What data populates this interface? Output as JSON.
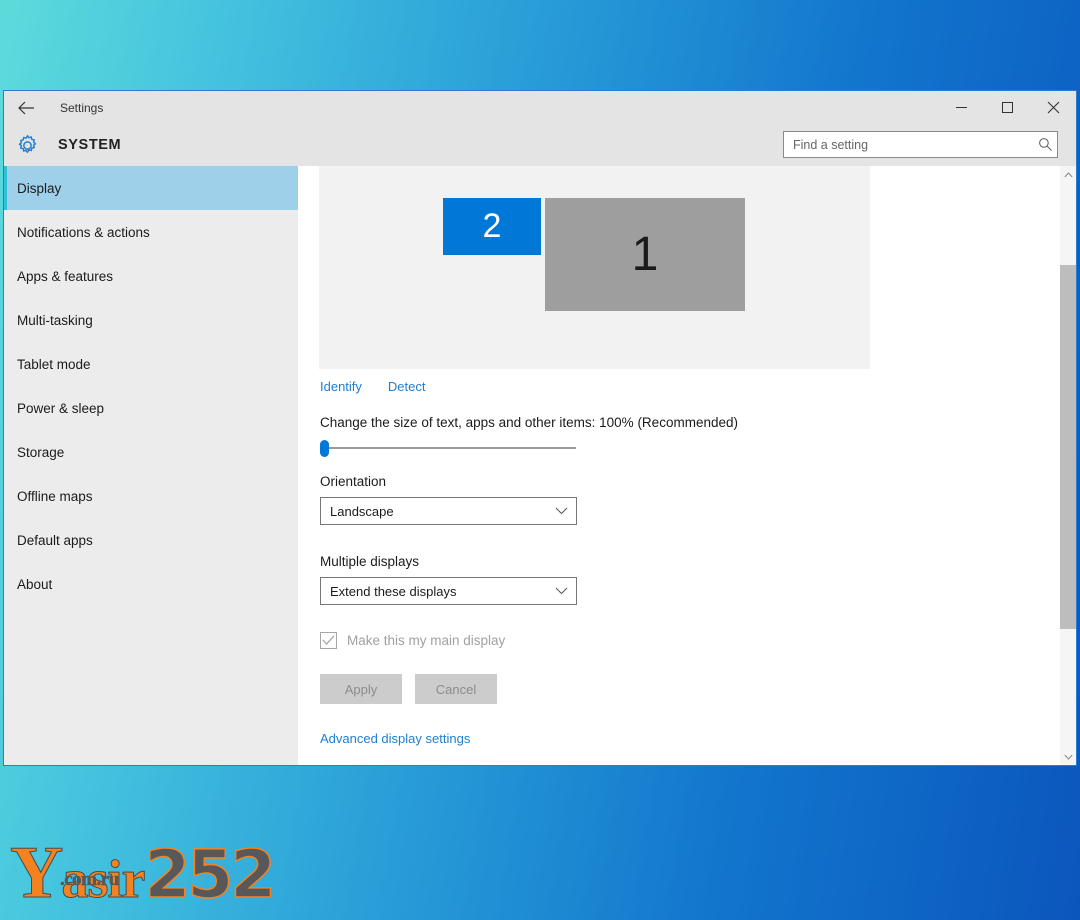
{
  "window": {
    "titlebar_title": "Settings",
    "back_icon": "back-arrow-icon",
    "minimize_label": "–",
    "maximize_label": "□",
    "close_label": "✕"
  },
  "header": {
    "gear_icon": "gear-icon",
    "title": "SYSTEM"
  },
  "search": {
    "placeholder": "Find a setting",
    "value": "",
    "icon": "search-icon"
  },
  "sidebar": {
    "items": [
      {
        "label": "Display",
        "active": true
      },
      {
        "label": "Notifications & actions",
        "active": false
      },
      {
        "label": "Apps & features",
        "active": false
      },
      {
        "label": "Multi-tasking",
        "active": false
      },
      {
        "label": "Tablet mode",
        "active": false
      },
      {
        "label": "Power & sleep",
        "active": false
      },
      {
        "label": "Storage",
        "active": false
      },
      {
        "label": "Offline maps",
        "active": false
      },
      {
        "label": "Default apps",
        "active": false
      },
      {
        "label": "About",
        "active": false
      }
    ]
  },
  "main": {
    "displays": [
      {
        "number": "2",
        "selected": true
      },
      {
        "number": "1",
        "selected": false
      }
    ],
    "identify_link": "Identify",
    "detect_link": "Detect",
    "scale_label": "Change the size of text, apps and other items: 100% (Recommended)",
    "scale_percent": "100%",
    "slider_value": 0,
    "orientation_label": "Orientation",
    "orientation_value": "Landscape",
    "multiple_displays_label": "Multiple displays",
    "multiple_displays_value": "Extend these displays",
    "main_display_checkbox_label": "Make this my main display",
    "main_display_checked": true,
    "main_display_disabled": true,
    "apply_label": "Apply",
    "cancel_label": "Cancel",
    "buttons_disabled": true,
    "advanced_link": "Advanced display settings"
  },
  "watermark": {
    "letter": "Y",
    "word": "asir",
    "domain": ".com.ru",
    "number": "252"
  },
  "colors": {
    "accent_blue": "#0078d7",
    "link_blue": "#1f7fd0",
    "sidebar_active": "#9fd0ea",
    "sidebar_bg": "#ececec",
    "chrome_gray": "#e4e4e4",
    "preview_bg": "#f2f2f2",
    "monitor_inactive": "#9e9e9e",
    "disabled_button": "#cccccc",
    "watermark_orange": "#f58220",
    "watermark_gray": "#58585a"
  }
}
